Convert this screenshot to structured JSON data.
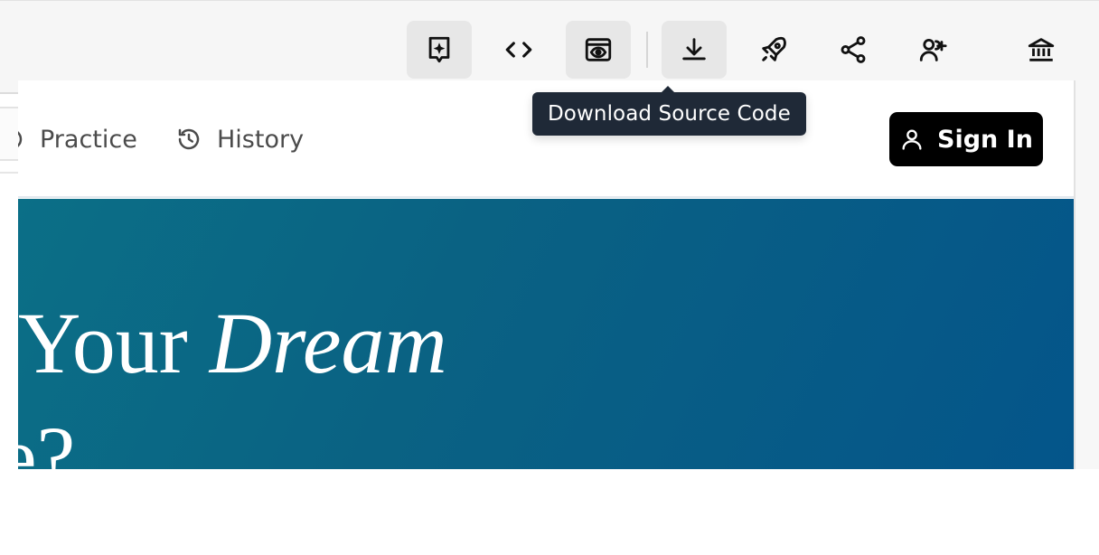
{
  "toolbar": {
    "buttons": [
      {
        "name": "ai-edit",
        "icon": "sparkle-message-icon",
        "active": true
      },
      {
        "name": "code",
        "icon": "code-brackets-icon",
        "active": false
      },
      {
        "name": "preview",
        "icon": "eye-window-icon",
        "active": true
      },
      {
        "name": "download",
        "icon": "download-icon",
        "active": true
      },
      {
        "name": "deploy",
        "icon": "rocket-icon",
        "active": false
      },
      {
        "name": "share",
        "icon": "share-icon",
        "active": false
      },
      {
        "name": "invite",
        "icon": "user-plus-icon",
        "active": false
      },
      {
        "name": "bank",
        "icon": "bank-icon",
        "active": false
      }
    ],
    "tooltip": "Download Source Code"
  },
  "browser": {
    "url": "",
    "refresh_icon": "refresh-icon",
    "open_external_icon": "external-link-icon"
  },
  "site": {
    "nav": {
      "items": [
        {
          "label": "Practice",
          "icon": "practice-icon"
        },
        {
          "label": "History",
          "icon": "history-icon"
        }
      ],
      "signin_label": "Sign In"
    },
    "hero": {
      "line1_plain": "Your ",
      "line1_italic": "Dream",
      "line2": "e?"
    }
  },
  "colors": {
    "hero_start": "#0b6f87",
    "hero_end": "#04558a",
    "tooltip_bg": "#1f2937",
    "signin_bg": "#000000"
  }
}
